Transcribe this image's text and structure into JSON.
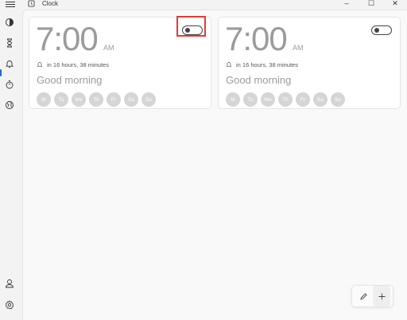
{
  "window": {
    "title": "Clock",
    "controls": [
      "–",
      "☐",
      "✕"
    ]
  },
  "alarms": [
    {
      "time": "7:00",
      "ampm": "AM",
      "remaining": "in 16 hours, 38 minutes",
      "name": "Good morning",
      "days": [
        "M",
        "Tu",
        "We",
        "Th",
        "Fr",
        "Sa",
        "Su"
      ],
      "enabled": false
    },
    {
      "time": "7:00",
      "ampm": "AM",
      "remaining": "in 16 hours, 38 minutes",
      "name": "Good morning",
      "days": [
        "M",
        "Tu",
        "We",
        "Th",
        "Fr",
        "Sa",
        "Su"
      ],
      "enabled": false
    }
  ],
  "nav": [
    "focus-sessions-icon",
    "timer-icon",
    "alarm-icon",
    "stopwatch-icon",
    "world-clock-icon",
    "account-icon",
    "settings-icon"
  ],
  "colors": {
    "accent": "#2b63c9",
    "highlight": "#e53935"
  }
}
